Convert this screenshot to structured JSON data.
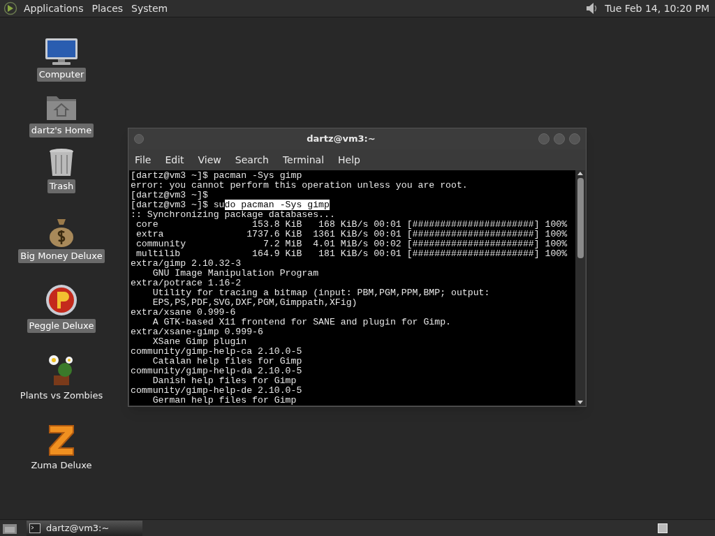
{
  "top_panel": {
    "menus": [
      "Applications",
      "Places",
      "System"
    ],
    "clock": "Tue Feb 14, 10:20 PM"
  },
  "desktop_icons": [
    {
      "kind": "computer",
      "label": "Computer",
      "selected": true
    },
    {
      "kind": "home",
      "label": "dartz's Home",
      "selected": true
    },
    {
      "kind": "trash",
      "label": "Trash",
      "selected": true
    },
    {
      "kind": "moneybag",
      "label": "Big Money Deluxe",
      "selected": true
    },
    {
      "kind": "ball",
      "label": "Peggle Deluxe",
      "selected": true
    },
    {
      "kind": "flowers",
      "label": "Plants vs Zombies",
      "selected": false
    },
    {
      "kind": "zuma",
      "label": "Zuma Deluxe",
      "selected": false
    }
  ],
  "terminal": {
    "title": "dartz@vm3:~",
    "menus": [
      "File",
      "Edit",
      "View",
      "Search",
      "Terminal",
      "Help"
    ],
    "lines": [
      [
        {
          "text": "[dartz@vm3 ~]$ pacman -Sys gimp",
          "selected": false
        }
      ],
      [
        {
          "text": "error: you cannot perform this operation unless you are root.",
          "selected": false
        }
      ],
      [
        {
          "text": "[dartz@vm3 ~]$",
          "selected": false
        }
      ],
      [
        {
          "text": "[dartz@vm3 ~]$ su",
          "selected": false
        },
        {
          "text": "do pacman -Sys gimp",
          "selected": true
        }
      ],
      [
        {
          "text": ":: Synchronizing package databases...",
          "selected": false
        }
      ],
      [
        {
          "text": " core                 153.8 KiB   168 KiB/s 00:01 [######################] 100%",
          "selected": false
        }
      ],
      [
        {
          "text": " extra               1737.6 KiB  1361 KiB/s 00:01 [######################] 100%",
          "selected": false
        }
      ],
      [
        {
          "text": " community              7.2 MiB  4.01 MiB/s 00:02 [######################] 100%",
          "selected": false
        }
      ],
      [
        {
          "text": " multilib             164.9 KiB   181 KiB/s 00:01 [######################] 100%",
          "selected": false
        }
      ],
      [
        {
          "text": "extra/gimp 2.10.32-3",
          "selected": false
        }
      ],
      [
        {
          "text": "    GNU Image Manipulation Program",
          "selected": false
        }
      ],
      [
        {
          "text": "extra/potrace 1.16-2",
          "selected": false
        }
      ],
      [
        {
          "text": "    Utility for tracing a bitmap (input: PBM,PGM,PPM,BMP; output:",
          "selected": false
        }
      ],
      [
        {
          "text": "    EPS,PS,PDF,SVG,DXF,PGM,Gimppath,XFig)",
          "selected": false
        }
      ],
      [
        {
          "text": "extra/xsane 0.999-6",
          "selected": false
        }
      ],
      [
        {
          "text": "    A GTK-based X11 frontend for SANE and plugin for Gimp.",
          "selected": false
        }
      ],
      [
        {
          "text": "extra/xsane-gimp 0.999-6",
          "selected": false
        }
      ],
      [
        {
          "text": "    XSane Gimp plugin",
          "selected": false
        }
      ],
      [
        {
          "text": "community/gimp-help-ca 2.10.0-5",
          "selected": false
        }
      ],
      [
        {
          "text": "    Catalan help files for Gimp",
          "selected": false
        }
      ],
      [
        {
          "text": "community/gimp-help-da 2.10.0-5",
          "selected": false
        }
      ],
      [
        {
          "text": "    Danish help files for Gimp",
          "selected": false
        }
      ],
      [
        {
          "text": "community/gimp-help-de 2.10.0-5",
          "selected": false
        }
      ],
      [
        {
          "text": "    German help files for Gimp",
          "selected": false
        }
      ]
    ]
  },
  "taskbar": {
    "tasks": [
      {
        "label": "dartz@vm3:~",
        "selected": true
      }
    ]
  }
}
